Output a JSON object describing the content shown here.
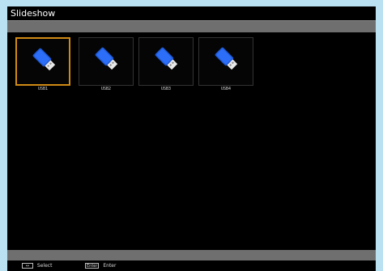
{
  "window": {
    "title": "Slideshow"
  },
  "devices": [
    {
      "label": "USB1",
      "icon": "usb-drive-icon",
      "selected": true
    },
    {
      "label": "USB2",
      "icon": "usb-drive-icon",
      "selected": false
    },
    {
      "label": "USB3",
      "icon": "usb-drive-icon",
      "selected": false
    },
    {
      "label": "USB4",
      "icon": "usb-drive-icon",
      "selected": false
    }
  ],
  "footer": {
    "select_key": "↔",
    "select_label": "Select",
    "enter_key": "Enter",
    "enter_label": "Enter"
  },
  "colors": {
    "selection_border": "#d08a15",
    "usb_body": "#1f5ad8",
    "usb_connector": "#e8e8e8"
  }
}
